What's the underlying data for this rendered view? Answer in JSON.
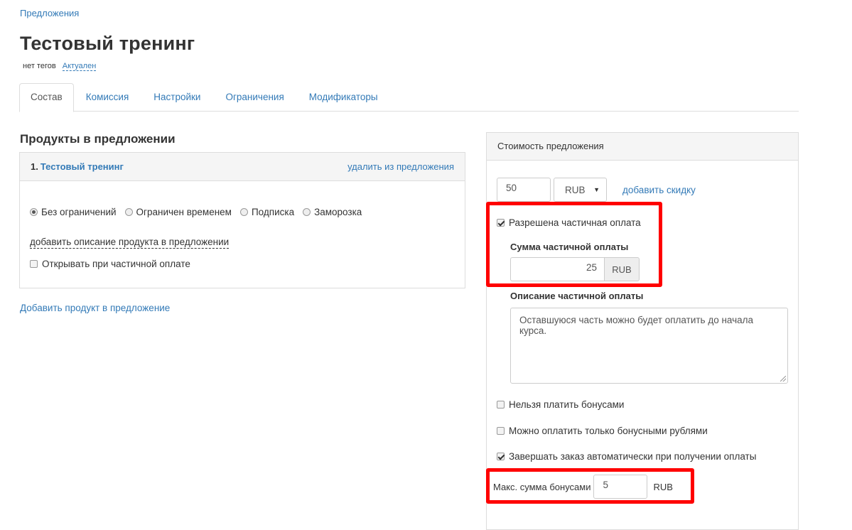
{
  "breadcrumb": "Предложения",
  "title": "Тестовый тренинг",
  "meta": {
    "tags": "нет тегов",
    "status": "Актуален"
  },
  "tabs": [
    {
      "label": "Состав"
    },
    {
      "label": "Комиссия"
    },
    {
      "label": "Настройки"
    },
    {
      "label": "Ограничения"
    },
    {
      "label": "Модификаторы"
    }
  ],
  "products": {
    "title": "Продукты в предложении",
    "item": {
      "number": "1.",
      "name": "Тестовый тренинг",
      "remove": "удалить из предложения",
      "radios": [
        "Без ограничений",
        "Ограничен временем",
        "Подписка",
        "Заморозка"
      ],
      "selected_radio": "Без ограничений",
      "add_description": "добавить описание продукта в предложении",
      "open_partial": "Открывать при частичной оплате"
    },
    "add_product": "Добавить продукт в предложение"
  },
  "cost": {
    "title": "Стоимость предложения",
    "price": "50",
    "currency": "RUB",
    "add_discount": "добавить скидку",
    "partial_allowed": "Разрешена частичная оплата",
    "partial_sum_label": "Сумма частичной оплаты",
    "partial_sum_value": "25",
    "partial_sum_unit": "RUB",
    "partial_desc_label": "Описание частичной оплаты",
    "partial_desc_value": "Оставшуюся часть можно будет оплатить до начала курса.",
    "no_bonuses": "Нельзя платить бонусами",
    "only_bonuses": "Можно оплатить только бонусными рублями",
    "auto_complete": "Завершать заказ автоматически при получении оплаты",
    "max_bonus_label": "Макс. сумма бонусами",
    "max_bonus_value": "5",
    "max_bonus_unit": "RUB"
  },
  "colors": {
    "link": "#337ab7",
    "highlight": "#ff0000",
    "panel_header": "#f5f5f5"
  }
}
